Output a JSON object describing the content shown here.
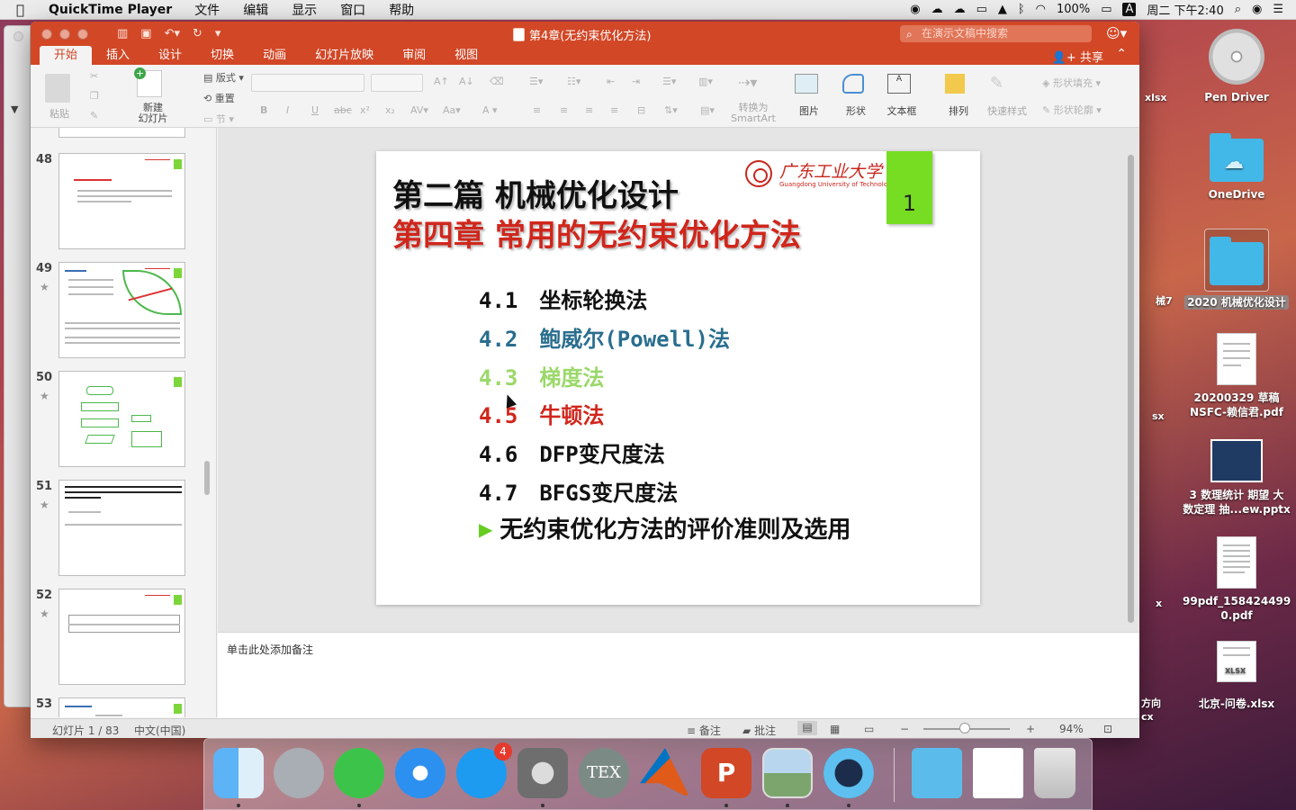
{
  "menubar": {
    "app_name": "QuickTime Player",
    "items": [
      "文件",
      "编辑",
      "显示",
      "窗口",
      "帮助"
    ],
    "battery": "100%",
    "input_method": "A",
    "clock": "周二 下午2:40"
  },
  "background_window": {
    "label_fragment": "▼"
  },
  "ppt": {
    "doc_title": "第4章(无约束优化方法)",
    "search_placeholder": "在演示文稿中搜索",
    "tabs": [
      "开始",
      "插入",
      "设计",
      "切换",
      "动画",
      "幻灯片放映",
      "审阅",
      "视图"
    ],
    "share_label": "共享",
    "ribbon": {
      "paste": "粘贴",
      "new_slide": "新建\n幻灯片",
      "layout": "版式",
      "reset": "重置",
      "section": "节",
      "convert_smartart": "转换为\nSmartArt",
      "picture": "图片",
      "shapes": "形状",
      "textbox": "文本框",
      "arrange": "排列",
      "quick_styles": "快速样式",
      "shape_fill": "形状填充",
      "shape_outline": "形状轮廓"
    },
    "thumbnails": [
      {
        "number": "48",
        "starred": false
      },
      {
        "number": "49",
        "starred": true
      },
      {
        "number": "50",
        "starred": true
      },
      {
        "number": "51",
        "starred": true
      },
      {
        "number": "52",
        "starred": true
      },
      {
        "number": "53",
        "starred": false
      }
    ],
    "slide": {
      "heading1": "第二篇 机械优化设计",
      "heading2": "第四章 常用的无约束优化方法",
      "university_cn": "广东工业大学",
      "university_en": "Guangdong University of Technology",
      "slide_number": "1",
      "items": [
        {
          "num": "4.1",
          "text": "坐标轮换法",
          "color": "#111111"
        },
        {
          "num": "4.2",
          "text": "鲍威尔(Powell)法",
          "color": "#2a6e8e"
        },
        {
          "num": "4.3",
          "text": "梯度法",
          "color": "#9bd86a"
        },
        {
          "num": "4.5",
          "text": "牛顿法",
          "color": "#d0261c"
        },
        {
          "num": "4.6",
          "text": "DFP变尺度法",
          "color": "#111111"
        },
        {
          "num": "4.7",
          "text": "BFGS变尺度法",
          "color": "#111111"
        }
      ],
      "last_item": "无约束优化方法的评价准则及选用"
    },
    "notes_placeholder": "单击此处添加备注",
    "status": {
      "slide_counter": "幻灯片 1 / 83",
      "language": "中文(中国)",
      "notes_btn": "备注",
      "comments_btn": "批注",
      "zoom": "94%"
    }
  },
  "desktop_icons": [
    {
      "label": "Pen Driver"
    },
    {
      "label": "OneDrive"
    },
    {
      "label": "2020 机械优化设计"
    },
    {
      "label": "20200329 草稿\nNSFC-赖信君.pdf"
    },
    {
      "label": "3 数理统计 期望 大\n数定理 抽...ew.pptx"
    },
    {
      "label": "99pdf_158424499\n0.pdf"
    },
    {
      "label": "北京-问卷.xlsx"
    }
  ],
  "edge_labels": [
    "xlsx",
    "械7",
    "sx",
    "x",
    "方向\ncx"
  ],
  "dock": {
    "appstore_badge": "4",
    "apps": [
      "finder",
      "launchpad",
      "wechat",
      "safari",
      "app-store",
      "system-preferences",
      "tex",
      "matlab",
      "powerpoint",
      "preview",
      "quicktime",
      "downloads-folder",
      "document",
      "trash"
    ]
  }
}
